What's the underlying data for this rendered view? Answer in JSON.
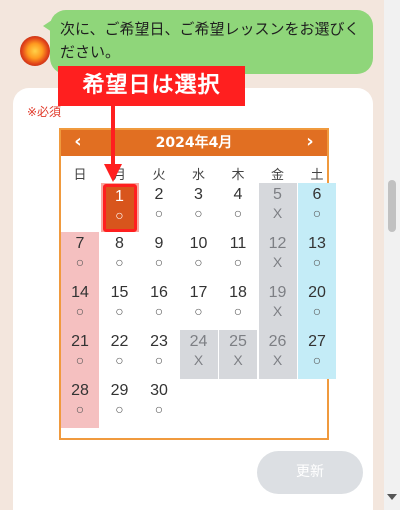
{
  "chat": {
    "message": "次に、ご希望日、ご希望レッスンをお選びください。"
  },
  "form": {
    "required_label": "※必須",
    "annotation": "希望日は選択",
    "update_button": "更新"
  },
  "calendar": {
    "title": "2024年4月",
    "prev_icon": "‹",
    "next_icon": "›",
    "weekdays": [
      "日",
      "月",
      "火",
      "水",
      "木",
      "金",
      "土"
    ],
    "available_mark": "○",
    "closed_mark": "X",
    "colors": {
      "header": "#e16f22",
      "sunday": "#f5c0c0",
      "saturday": "#c4ecf7",
      "closed": "#d6d8dc",
      "selected": "#d8551c"
    },
    "days": [
      {
        "d": "1",
        "m": "○",
        "dow": 1,
        "week": 0,
        "state": "selected"
      },
      {
        "d": "2",
        "m": "○",
        "dow": 2,
        "week": 0,
        "state": "open"
      },
      {
        "d": "3",
        "m": "○",
        "dow": 3,
        "week": 0,
        "state": "open"
      },
      {
        "d": "4",
        "m": "○",
        "dow": 4,
        "week": 0,
        "state": "open"
      },
      {
        "d": "5",
        "m": "X",
        "dow": 5,
        "week": 0,
        "state": "closed"
      },
      {
        "d": "6",
        "m": "○",
        "dow": 6,
        "week": 0,
        "state": "sat"
      },
      {
        "d": "7",
        "m": "○",
        "dow": 0,
        "week": 1,
        "state": "sun"
      },
      {
        "d": "8",
        "m": "○",
        "dow": 1,
        "week": 1,
        "state": "open"
      },
      {
        "d": "9",
        "m": "○",
        "dow": 2,
        "week": 1,
        "state": "open"
      },
      {
        "d": "10",
        "m": "○",
        "dow": 3,
        "week": 1,
        "state": "open"
      },
      {
        "d": "11",
        "m": "○",
        "dow": 4,
        "week": 1,
        "state": "open"
      },
      {
        "d": "12",
        "m": "X",
        "dow": 5,
        "week": 1,
        "state": "closed"
      },
      {
        "d": "13",
        "m": "○",
        "dow": 6,
        "week": 1,
        "state": "sat"
      },
      {
        "d": "14",
        "m": "○",
        "dow": 0,
        "week": 2,
        "state": "sun"
      },
      {
        "d": "15",
        "m": "○",
        "dow": 1,
        "week": 2,
        "state": "open"
      },
      {
        "d": "16",
        "m": "○",
        "dow": 2,
        "week": 2,
        "state": "open"
      },
      {
        "d": "17",
        "m": "○",
        "dow": 3,
        "week": 2,
        "state": "open"
      },
      {
        "d": "18",
        "m": "○",
        "dow": 4,
        "week": 2,
        "state": "open"
      },
      {
        "d": "19",
        "m": "X",
        "dow": 5,
        "week": 2,
        "state": "closed"
      },
      {
        "d": "20",
        "m": "○",
        "dow": 6,
        "week": 2,
        "state": "sat"
      },
      {
        "d": "21",
        "m": "○",
        "dow": 0,
        "week": 3,
        "state": "sun"
      },
      {
        "d": "22",
        "m": "○",
        "dow": 1,
        "week": 3,
        "state": "open"
      },
      {
        "d": "23",
        "m": "○",
        "dow": 2,
        "week": 3,
        "state": "open"
      },
      {
        "d": "24",
        "m": "X",
        "dow": 3,
        "week": 3,
        "state": "closed"
      },
      {
        "d": "25",
        "m": "X",
        "dow": 4,
        "week": 3,
        "state": "closed"
      },
      {
        "d": "26",
        "m": "X",
        "dow": 5,
        "week": 3,
        "state": "closed"
      },
      {
        "d": "27",
        "m": "○",
        "dow": 6,
        "week": 3,
        "state": "sat"
      },
      {
        "d": "28",
        "m": "○",
        "dow": 0,
        "week": 4,
        "state": "sun"
      },
      {
        "d": "29",
        "m": "○",
        "dow": 1,
        "week": 4,
        "state": "open"
      },
      {
        "d": "30",
        "m": "○",
        "dow": 2,
        "week": 4,
        "state": "open"
      }
    ]
  }
}
